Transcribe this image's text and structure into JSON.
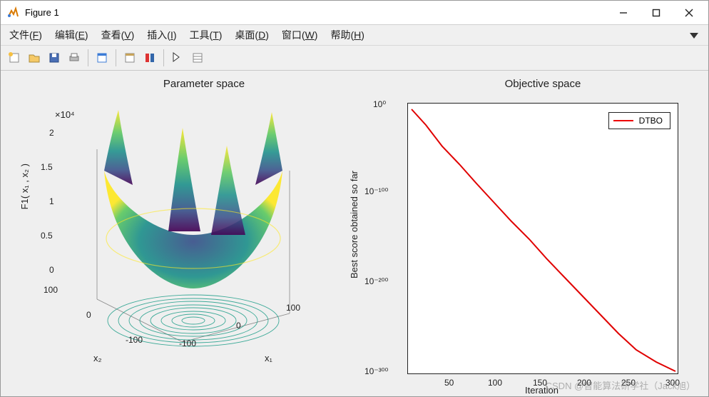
{
  "window": {
    "title": "Figure 1"
  },
  "menu": {
    "file": "文件",
    "file_u": "F",
    "edit": "编辑",
    "edit_u": "E",
    "view": "查看",
    "view_u": "V",
    "insert": "插入",
    "insert_u": "I",
    "tools": "工具",
    "tools_u": "T",
    "desktop": "桌面",
    "desktop_u": "D",
    "window": "窗口",
    "window_u": "W",
    "help": "帮助",
    "help_u": "H"
  },
  "left": {
    "title": "Parameter space",
    "z_expo": "×10⁴",
    "zlabel": "F1( x₁ , x₂ )",
    "x1label": "x₁",
    "x2label": "x₂",
    "zticks": [
      "0",
      "0.5",
      "1",
      "1.5",
      "2"
    ],
    "x1ticks": [
      "-100",
      "0",
      "100"
    ],
    "x2ticks": [
      "-100",
      "0",
      "100"
    ]
  },
  "right": {
    "title": "Objective space",
    "ylabel": "Best score obtained so far",
    "xlabel": "Iteration",
    "xticks": [
      "50",
      "100",
      "150",
      "200",
      "250",
      "300"
    ],
    "yticks": [
      "10⁻³⁰⁰",
      "10⁻²⁰⁰",
      "10⁻¹⁰⁰",
      "10⁰"
    ],
    "legend": "DTBO"
  },
  "watermark": "CSDN @智能算法研学社（Jack旭）",
  "chart_data": [
    {
      "type": "surface",
      "title": "Parameter space",
      "xlabel": "x₁",
      "ylabel": "x₂",
      "zlabel": "F1( x₁ , x₂ )",
      "xlim": [
        -100,
        100
      ],
      "ylim": [
        -100,
        100
      ],
      "zlim": [
        0,
        20000
      ],
      "z_scale": "×10⁴",
      "x1_ticks": [
        -100,
        0,
        100
      ],
      "x2_ticks": [
        -100,
        0,
        100
      ],
      "z_ticks": [
        0,
        0.5,
        1,
        1.5,
        2
      ],
      "note": "3D surface of benchmark function F1 over x₁,x₂ grid with contour projection on base plane; colormap viridis-like"
    },
    {
      "type": "line",
      "title": "Objective space",
      "xlabel": "Iteration",
      "ylabel": "Best score obtained so far",
      "xlim": [
        1,
        300
      ],
      "ylim": [
        1e-300,
        1
      ],
      "yscale": "log",
      "x_ticks": [
        50,
        100,
        150,
        200,
        250,
        300
      ],
      "y_tick_labels": [
        "10⁻³⁰⁰",
        "10⁻²⁰⁰",
        "10⁻¹⁰⁰",
        "10⁰"
      ],
      "legend_position": "top-right",
      "series": [
        {
          "name": "DTBO",
          "color": "#e00000",
          "x": [
            1,
            20,
            40,
            60,
            80,
            100,
            120,
            140,
            160,
            180,
            200,
            220,
            240,
            260,
            280,
            300
          ],
          "y": [
            1,
            1e-15,
            1e-35,
            1e-55,
            1e-75,
            1e-95,
            1e-115,
            1e-135,
            1e-155,
            1e-175,
            1e-195,
            1e-215,
            1e-235,
            1e-255,
            1e-278,
            1e-300
          ]
        }
      ]
    }
  ]
}
